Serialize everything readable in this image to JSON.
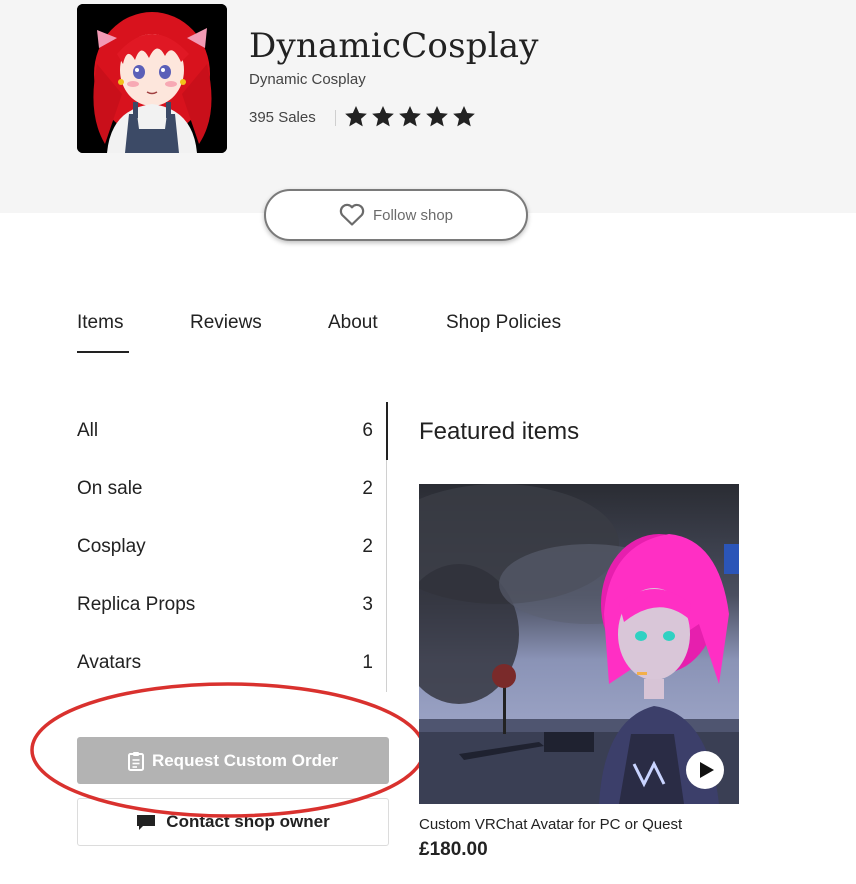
{
  "shop": {
    "name": "DynamicCosplay",
    "display_name": "Dynamic Cosplay",
    "sales": "395 Sales",
    "rating_stars": 5,
    "follow_label": "Follow shop"
  },
  "tabs": [
    {
      "label": "Items",
      "active": true
    },
    {
      "label": "Reviews"
    },
    {
      "label": "About"
    },
    {
      "label": "Shop Policies"
    }
  ],
  "categories": [
    {
      "label": "All",
      "count": "6"
    },
    {
      "label": "On sale",
      "count": "2"
    },
    {
      "label": "Cosplay",
      "count": "2"
    },
    {
      "label": "Replica Props",
      "count": "3"
    },
    {
      "label": "Avatars",
      "count": "1"
    }
  ],
  "actions": {
    "request_custom_order": "Request Custom Order",
    "contact_shop_owner": "Contact shop owner"
  },
  "featured": {
    "title": "Featured items",
    "items": [
      {
        "title": "Custom VRChat Avatar for PC or Quest",
        "price": "£180.00"
      }
    ]
  },
  "colors": {
    "annotation_ellipse": "#d9312e",
    "request_button_bg": "#b3b3b3",
    "header_bg": "#f5f5f5"
  },
  "icons": {
    "stars": "star-icon",
    "follow": "heart-icon",
    "request": "clipboard-icon",
    "contact": "mail-icon",
    "video": "play-icon"
  }
}
